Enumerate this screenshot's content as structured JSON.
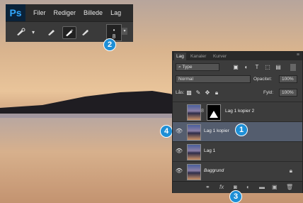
{
  "app": {
    "logo": "Ps",
    "menu": [
      "Filer",
      "Rediger",
      "Billede",
      "Lag"
    ]
  },
  "toolbar": {
    "brush_size": "8"
  },
  "badges": [
    "1",
    "2",
    "3",
    "4"
  ],
  "layers_panel": {
    "tabs": [
      "Lag",
      "Kanaler",
      "Kurver"
    ],
    "filter_kind": "Type",
    "blend_mode": "Normal",
    "opacity_label": "Opacitet:",
    "opacity_value": "100%",
    "lock_label": "Lås:",
    "fill_label": "Fyld:",
    "fill_value": "100%",
    "layers": [
      {
        "name": "Lag 1 kopier 2",
        "visible": false,
        "selected": false,
        "has_mask": true
      },
      {
        "name": "Lag 1 kopier",
        "visible": true,
        "selected": true,
        "has_mask": false
      },
      {
        "name": "Lag 1",
        "visible": true,
        "selected": false,
        "has_mask": false
      },
      {
        "name": "Baggrund",
        "visible": true,
        "selected": false,
        "has_mask": false,
        "locked": true
      }
    ]
  }
}
